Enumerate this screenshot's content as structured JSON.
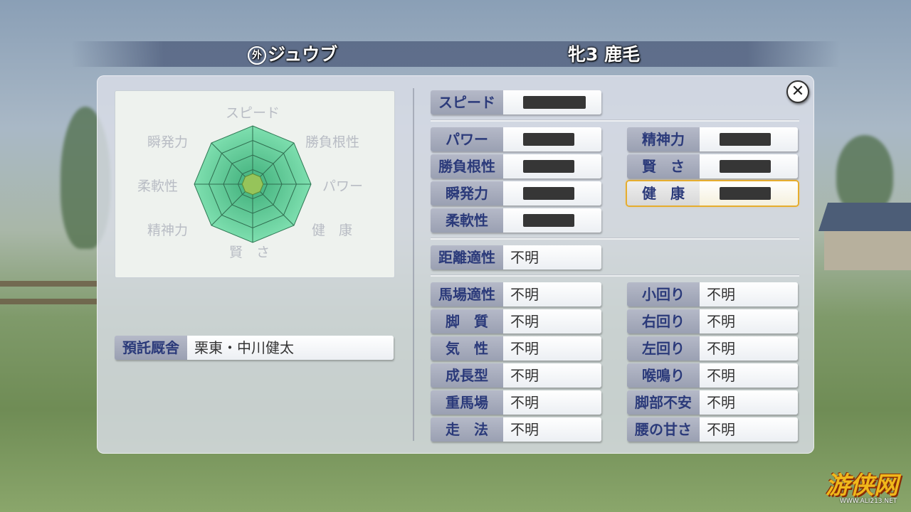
{
  "header": {
    "origin_mark": "外",
    "horse_name": "ジュウブ",
    "horse_info": "牝3 鹿毛"
  },
  "radar": {
    "labels": [
      "スピード",
      "勝負根性",
      "パワー",
      "健　康",
      "賢　さ",
      "精神力",
      "柔軟性",
      "瞬発力"
    ],
    "values": [
      0.18,
      0.18,
      0.18,
      0.18,
      0.18,
      0.18,
      0.18,
      0.18
    ],
    "colors": {
      "outer": "#7fe0b0",
      "inner": "#3fae7a",
      "value": "#96c45a"
    }
  },
  "stable": {
    "label": "預託厩舎",
    "value": "栗東・中川健太"
  },
  "stats_top": {
    "speed": {
      "label": "スピード"
    }
  },
  "stats_main_left": [
    {
      "label": "パワー"
    },
    {
      "label": "勝負根性"
    },
    {
      "label": "瞬発力"
    },
    {
      "label": "柔軟性"
    }
  ],
  "stats_main_right": [
    {
      "label": "精神力"
    },
    {
      "label": "賢　さ"
    },
    {
      "label": "健　康"
    }
  ],
  "distance": {
    "label": "距離適性",
    "value": "不明"
  },
  "aptitude_left": [
    {
      "label": "馬場適性",
      "value": "不明"
    },
    {
      "label": "脚　質",
      "value": "不明"
    },
    {
      "label": "気　性",
      "value": "不明"
    },
    {
      "label": "成長型",
      "value": "不明"
    },
    {
      "label": "重馬場",
      "value": "不明"
    },
    {
      "label": "走　法",
      "value": "不明"
    }
  ],
  "aptitude_right": [
    {
      "label": "小回り",
      "value": "不明"
    },
    {
      "label": "右回り",
      "value": "不明"
    },
    {
      "label": "左回り",
      "value": "不明"
    },
    {
      "label": "喉鳴り",
      "value": "不明"
    },
    {
      "label": "脚部不安",
      "value": "不明"
    },
    {
      "label": "腰の甘さ",
      "value": "不明"
    }
  ],
  "close_glyph": "✕",
  "watermark": {
    "logo": "游侠网",
    "url": "WWW.ALI213.NET"
  }
}
